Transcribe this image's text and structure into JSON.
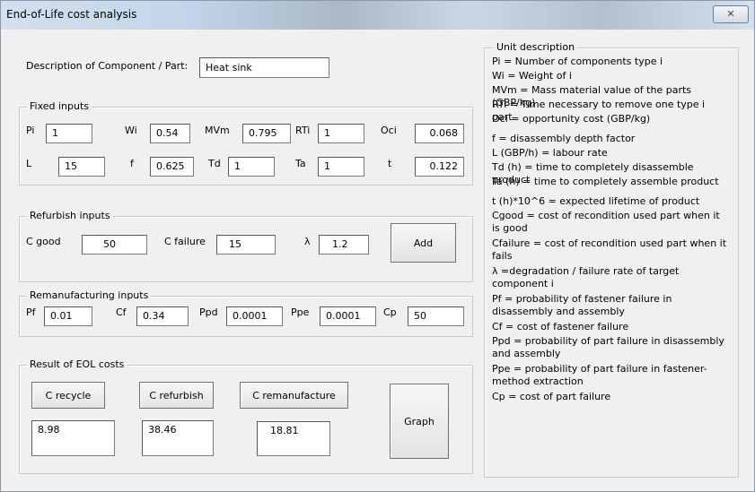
{
  "window": {
    "title": "End-of-Life cost analysis",
    "close_glyph": "✕"
  },
  "description": {
    "label": "Description of Component / Part:",
    "value": "Heat sink"
  },
  "fixed_inputs": {
    "title": "Fixed inputs",
    "fields": {
      "pi": {
        "label": "Pi",
        "value": "1"
      },
      "wi": {
        "label": "Wi",
        "value": "0.54"
      },
      "mvm": {
        "label": "MVm",
        "value": "0.795"
      },
      "rti": {
        "label": "RTi",
        "value": "1"
      },
      "oci": {
        "label": "Oci",
        "value": "0.068"
      },
      "l": {
        "label": "L",
        "value": "15"
      },
      "f": {
        "label": "f",
        "value": "0.625"
      },
      "td": {
        "label": "Td",
        "value": "1"
      },
      "ta": {
        "label": "Ta",
        "value": "1"
      },
      "t": {
        "label": "t",
        "value": "0.122"
      }
    }
  },
  "refurbish_inputs": {
    "title": "Refurbish inputs",
    "c_good": {
      "label": "C good",
      "value": "50"
    },
    "c_failure": {
      "label": "C failure",
      "value": "15"
    },
    "lambda": {
      "label": "λ",
      "value": "1.2"
    },
    "add_label": "Add"
  },
  "reman_inputs": {
    "title": "Remanufacturing inputs",
    "pf": {
      "label": "Pf",
      "value": "0.01"
    },
    "cf": {
      "label": "Cf",
      "value": "0.34"
    },
    "ppd": {
      "label": "Ppd",
      "value": "0.0001"
    },
    "ppe": {
      "label": "Ppe",
      "value": "0.0001"
    },
    "cp": {
      "label": "Cp",
      "value": "50"
    }
  },
  "results": {
    "title": "Result of EOL costs",
    "recycle": {
      "label": "C recycle",
      "value": "8.98"
    },
    "refurbish": {
      "label": "C refurbish",
      "value": "38.46"
    },
    "remanufacture": {
      "label": "C remanufacture",
      "value": "18.81"
    },
    "graph_label": "Graph"
  },
  "unit_description": {
    "title": "Unit description",
    "items": [
      "Pi = Number of components type i",
      "Wi = Weight of i",
      "MVm = Mass material value of the parts (GBP/kg)",
      "RTi = Time necessary to remove one type i part",
      "Oci = opportunity cost (GBP/kg)",
      "f = disassembly depth factor",
      "L (GBP/h) = labour rate",
      "Td (h) = time to completely disassemble product",
      "Ta (h) = time to completely assemble product",
      "t (h)*10^6 = expected lifetime of product",
      "Cgood = cost of recondition used part when it is good",
      "Cfailure = cost of recondition used part when it fails",
      "λ =degradation / failure rate of target component i",
      "Pf = probability of fastener failure in disassembly  and assembly",
      "Cf = cost of fastener failure",
      "Ppd = probability of part failure in disassembly and assembly",
      "Ppe = probability of part failure in fastener-method extraction",
      "Cp = cost of part failure"
    ]
  }
}
